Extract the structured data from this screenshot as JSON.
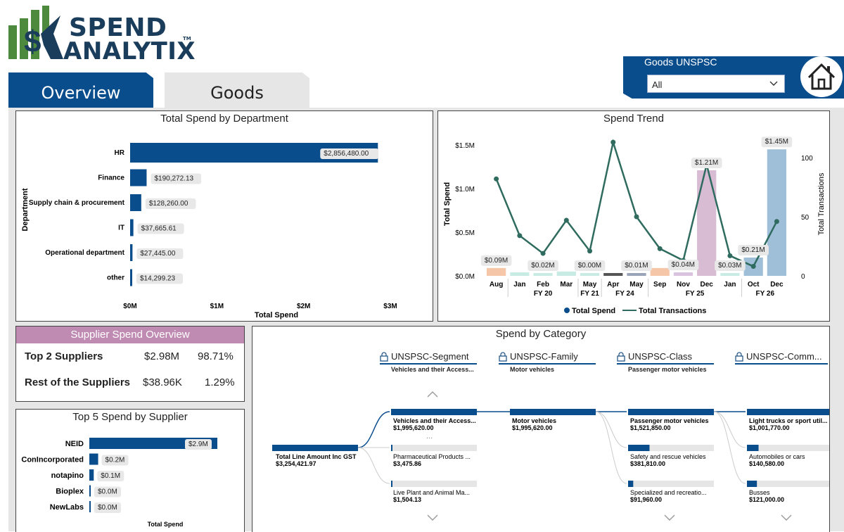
{
  "brand": {
    "line1": "SPEND",
    "line2": "ANALYTIX",
    "tm": "TM",
    "colors": {
      "green": "#4e8a3e",
      "navy": "#1a3d5c"
    }
  },
  "tabs": [
    {
      "label": "Overview",
      "active": true
    },
    {
      "label": "Goods",
      "active": false
    }
  ],
  "filter": {
    "label": "Goods UNSPSC",
    "value": "All"
  },
  "home_icon": "home-icon",
  "colors": {
    "accent": "#0a4d8c",
    "pink": "#c08bb2",
    "line": "#2f6b5e"
  },
  "dept_chart": {
    "title": "Total Spend by Department",
    "xlabel": "Total Spend",
    "ylabel": "Department"
  },
  "trend_chart": {
    "title": "Spend Trend",
    "ylabel_left": "Total Spend",
    "ylabel_right": "Total Transactions",
    "legend": [
      "Total Spend",
      "Total Transactions"
    ]
  },
  "supplier_overview": {
    "title": "Supplier Spend Overview",
    "rows": [
      {
        "label": "Top 2 Suppliers",
        "amount": "$2.98M",
        "pct": "98.71%"
      },
      {
        "label": "Rest of the Suppliers",
        "amount": "$38.96K",
        "pct": "1.29%"
      }
    ]
  },
  "top5": {
    "title": "Top 5 Spend by Supplier",
    "xlabel": "Total Spend"
  },
  "category": {
    "title": "Spend by Category",
    "levels": [
      {
        "name": "UNSPSC-Segment",
        "sub": "Vehicles and their Access..."
      },
      {
        "name": "UNSPSC-Family",
        "sub": "Motor vehicles"
      },
      {
        "name": "UNSPSC-Class",
        "sub": "Passenger motor vehicles"
      },
      {
        "name": "UNSPSC-Comm...",
        "sub": ""
      }
    ],
    "root": {
      "label": "Total Line Amount Inc GST",
      "value": "$3,254,421.97"
    },
    "segment": [
      {
        "label": "Vehicles and their Access...",
        "value": "$1,995,620.00",
        "fraction": 1.0
      },
      {
        "label": "Pharmaceutical Products ...",
        "value": "$3,475.86",
        "fraction": 0.002
      },
      {
        "label": "Live Plant and Animal Ma...",
        "value": "$1,504.13",
        "fraction": 0.001
      }
    ],
    "family": [
      {
        "label": "Motor vehicles",
        "value": "$1,995,620.00",
        "fraction": 1.0
      }
    ],
    "class": [
      {
        "label": "Passenger motor vehicles",
        "value": "$1,521,850.00",
        "fraction": 1.0
      },
      {
        "label": "Safety and rescue vehicles",
        "value": "$381,810.00",
        "fraction": 0.25
      },
      {
        "label": "Specialized and recreatio...",
        "value": "$91,960.00",
        "fraction": 0.06
      }
    ],
    "commodity": [
      {
        "label": "Light trucks or sport util...",
        "value": "$1,001,770.00",
        "fraction": 1.0
      },
      {
        "label": "Automobiles or cars",
        "value": "$140,580.00",
        "fraction": 0.14
      },
      {
        "label": "Busses",
        "value": "$121,000.00",
        "fraction": 0.12
      }
    ],
    "more": "...",
    "commodity_label_visible": "Light trucks or sport util"
  },
  "chart_data": [
    {
      "type": "bar",
      "title": "Total Spend by Department",
      "xlabel": "Total Spend",
      "ylabel": "Department",
      "orientation": "horizontal",
      "categories": [
        "HR",
        "Finance",
        "Supply chain & procurement",
        "IT",
        "Operational department",
        "other"
      ],
      "values": [
        2856480.0,
        190272.13,
        128260.0,
        37665.61,
        27445.0,
        14299.23
      ],
      "data_labels": [
        "$2,856,480.00",
        "$190,272.13",
        "$128,260.00",
        "$37,665.61",
        "$27,445.00",
        "$14,299.23"
      ],
      "xticks": [
        "$0M",
        "$1M",
        "$2M",
        "$3M"
      ],
      "xlim": [
        0,
        3000000
      ],
      "color": "#0a4d8c"
    },
    {
      "type": "bar",
      "title": "Spend Trend",
      "ylabel": "Total Spend",
      "y2label": "Total Transactions",
      "categories": [
        "Aug",
        "Jan",
        "Feb",
        "Mar",
        "May",
        "Apr",
        "May",
        "Sep",
        "Nov",
        "Dec",
        "Jan",
        "Oct",
        "Dec"
      ],
      "groups": [
        {
          "label": "",
          "start": 0,
          "end": 0
        },
        {
          "label": "FY 20",
          "start": 1,
          "end": 3
        },
        {
          "label": "FY 21",
          "start": 4,
          "end": 4
        },
        {
          "label": "FY 24",
          "start": 5,
          "end": 6
        },
        {
          "label": "FY 25",
          "start": 7,
          "end": 10
        },
        {
          "label": "FY 26",
          "start": 11,
          "end": 12
        }
      ],
      "series": [
        {
          "name": "Total Spend",
          "kind": "bar",
          "values": [
            0.09,
            0.04,
            0.02,
            0.05,
            0.0,
            0.03,
            0.01,
            0.09,
            0.04,
            1.21,
            0.03,
            0.21,
            1.45
          ],
          "colors": [
            "#f5c6a8",
            "#c8ece4",
            "#c8ece4",
            "#c8ece4",
            "#c8ece4",
            "#555555",
            "#9aa4b8",
            "#f5c6a8",
            "#d9c3df",
            "#d7bcd4",
            "#c8ece4",
            "#9fbfd8",
            "#9fbfd8"
          ]
        },
        {
          "name": "Total Transactions",
          "kind": "line",
          "values": [
            82,
            34,
            19,
            47,
            21,
            113,
            50,
            23,
            13,
            94,
            17,
            8,
            46
          ],
          "color": "#2f6b5e"
        }
      ],
      "data_labels": [
        {
          "index": 0,
          "text": "$0.09M"
        },
        {
          "index": 2,
          "text": "$0.02M"
        },
        {
          "index": 4,
          "text": "$0.00M"
        },
        {
          "index": 6,
          "text": "$0.01M"
        },
        {
          "index": 8,
          "text": "$0.04M"
        },
        {
          "index": 9,
          "text": "$1.21M"
        },
        {
          "index": 10,
          "text": "$0.03M"
        },
        {
          "index": 11,
          "text": "$0.21M"
        },
        {
          "index": 12,
          "text": "$1.45M"
        }
      ],
      "yticks": [
        "$0.0M",
        "$0.5M",
        "$1.0M",
        "$1.5M"
      ],
      "ylim": [
        0,
        1.5
      ],
      "y2ticks": [
        "0",
        "50",
        "100"
      ],
      "y2lim": [
        0,
        100
      ],
      "legend": "bottom"
    },
    {
      "type": "bar",
      "title": "Top 5 Spend by Supplier",
      "xlabel": "Total Spend",
      "orientation": "horizontal",
      "categories": [
        "NEID",
        "ConIncorporated",
        "notapino",
        "Bioplex",
        "NewLabs"
      ],
      "values": [
        2.9,
        0.2,
        0.1,
        0.0,
        0.0
      ],
      "data_labels": [
        "$2.9M",
        "$0.2M",
        "$0.1M",
        "$0.0M",
        "$0.0M"
      ],
      "color": "#0a4d8c"
    }
  ]
}
